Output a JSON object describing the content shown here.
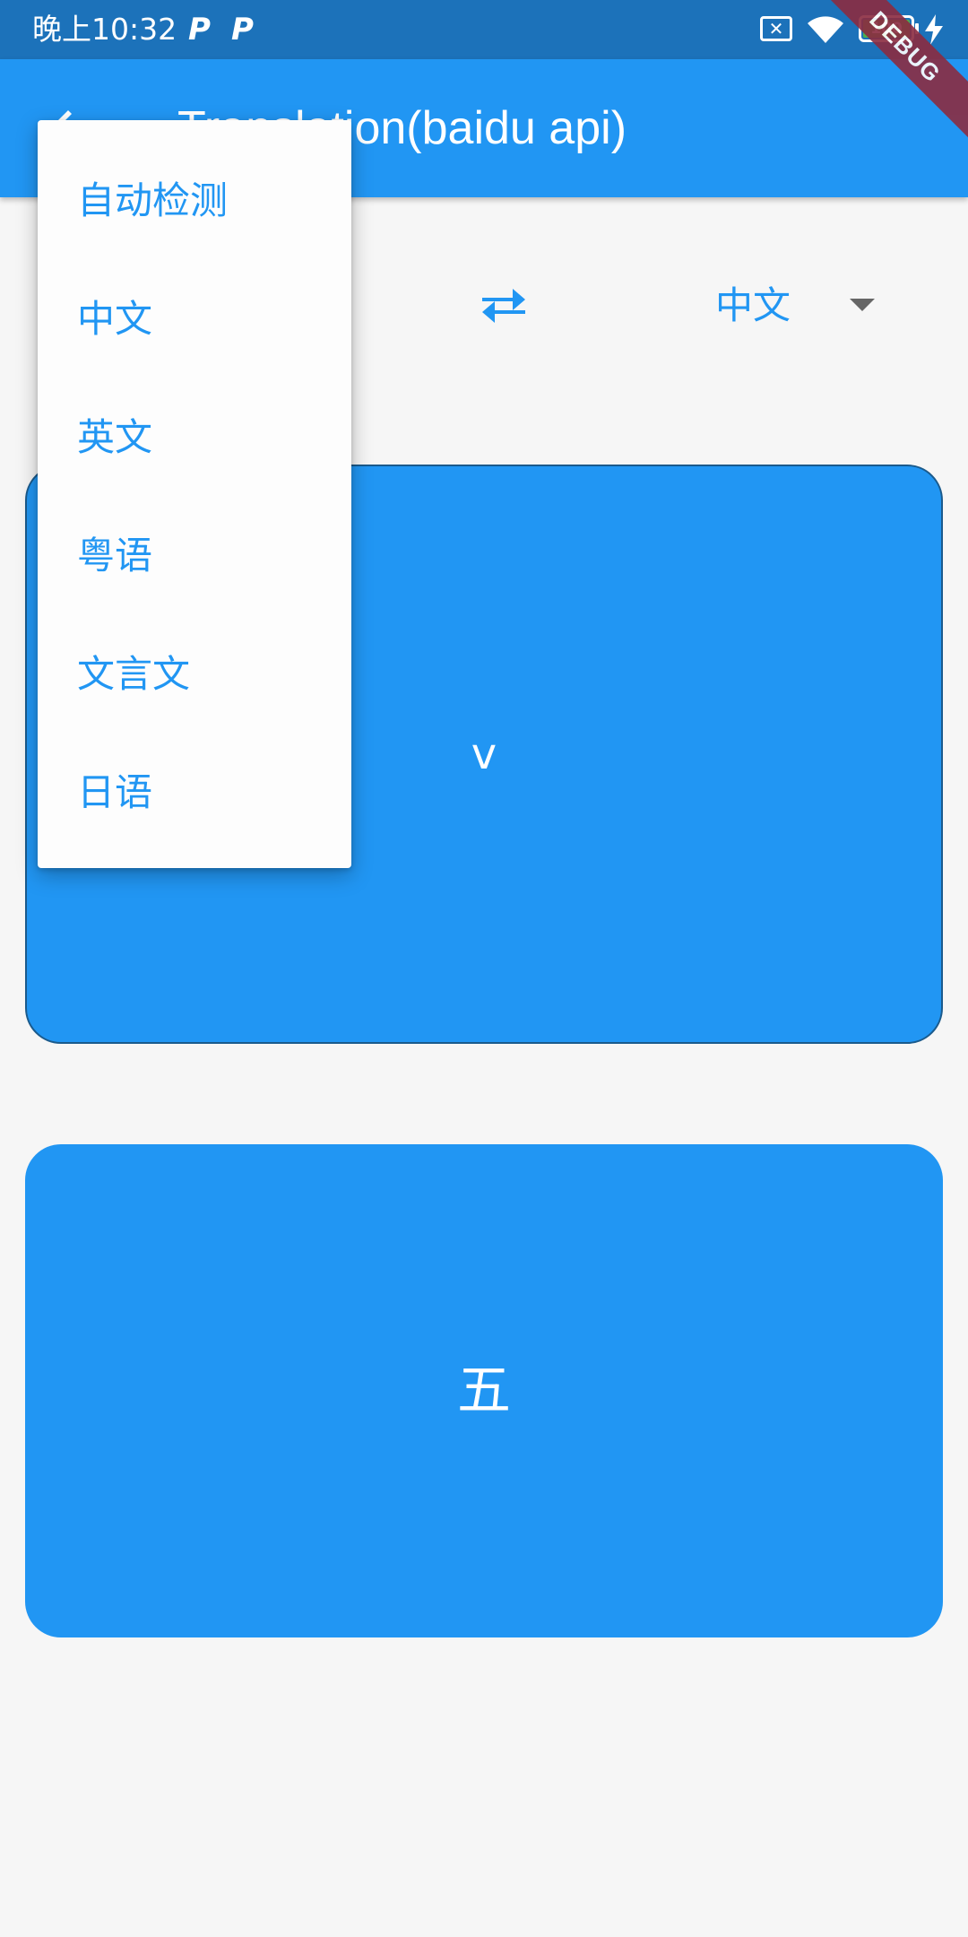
{
  "status_bar": {
    "time": "晚上10:32",
    "notification_1": "P",
    "notification_2": "P",
    "battery_level": "100",
    "icons": [
      "p-notification-icon",
      "p-notification-icon",
      "sim-disabled-icon",
      "wifi-icon",
      "battery-icon",
      "charging-bolt-icon"
    ]
  },
  "app_bar": {
    "title": "Translation(baidu api)",
    "back_icon": "back-arrow-icon"
  },
  "debug_banner": "DEBUG",
  "language_row": {
    "swap_icon": "swap-arrows-icon",
    "target_language": "中文",
    "dropdown_icon": "caret-down-icon"
  },
  "input_card": {
    "text": "v"
  },
  "output_card": {
    "text": "五"
  },
  "language_menu": {
    "items": [
      "自动检测",
      "中文",
      "英文",
      "粤语",
      "文言文",
      "日语"
    ]
  },
  "colors": {
    "primary": "#2196f3",
    "status_bar": "#1c72ba",
    "background": "#f6f6f6",
    "debug_banner": "#8b2c41"
  }
}
